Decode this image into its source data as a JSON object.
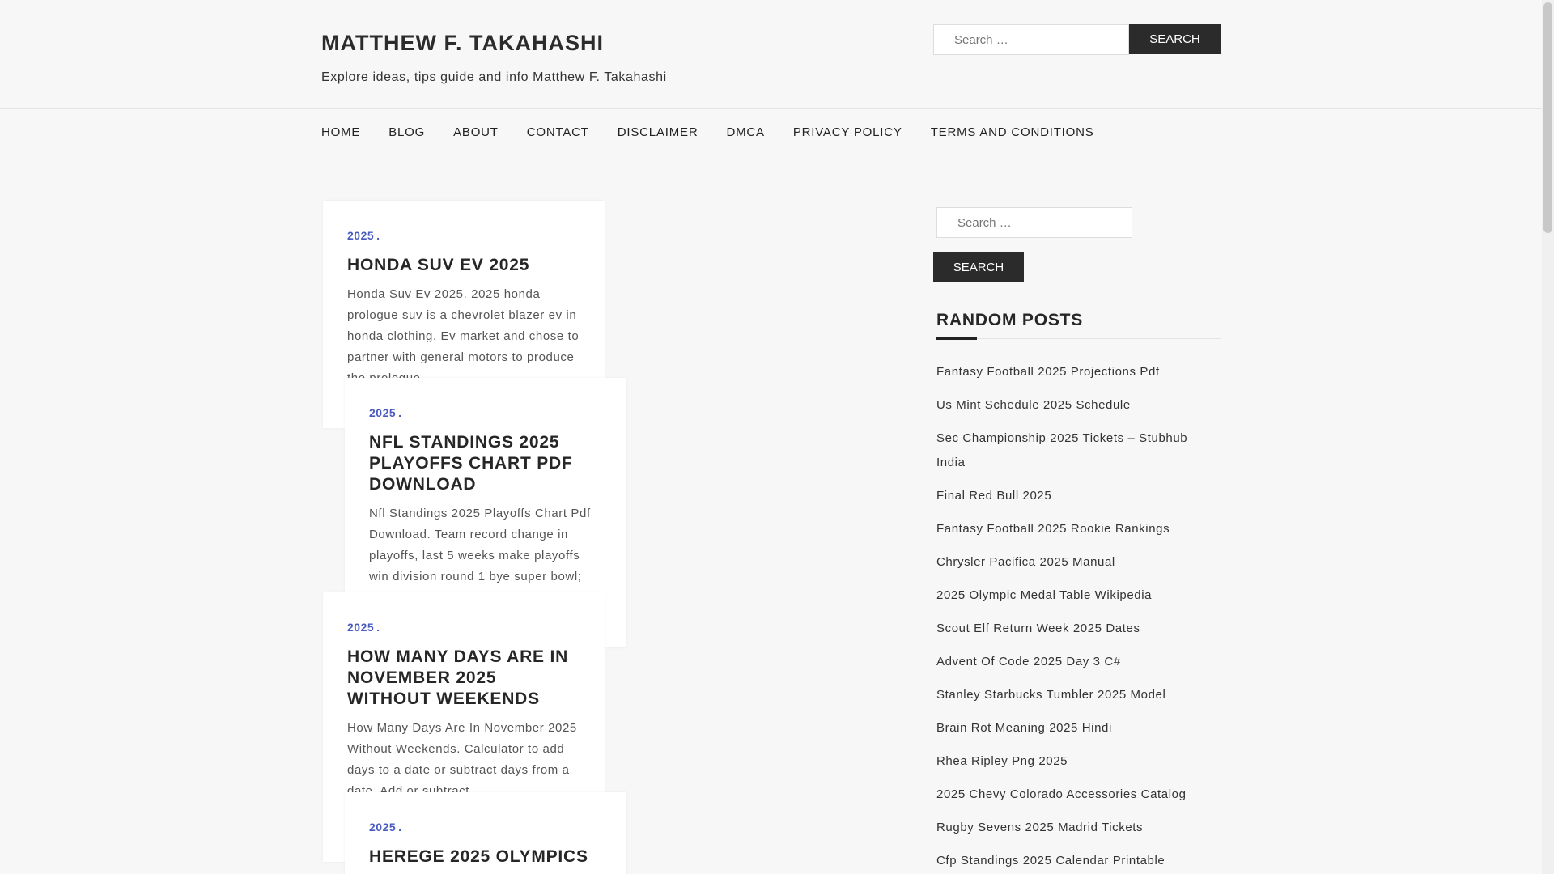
{
  "site": {
    "title": "MATTHEW F. TAKAHASHI",
    "description": "Explore ideas, tips guide and info Matthew F. Takahashi"
  },
  "header_search": {
    "placeholder": "Search …",
    "button": "Search"
  },
  "nav": [
    "HOME",
    "BLOG",
    "ABOUT",
    "CONTACT",
    "DISCLAIMER",
    "DMCA",
    "PRIVACY POLICY",
    "TERMS AND CONDITIONS"
  ],
  "posts": [
    {
      "category": "2025",
      "title": "HONDA SUV EV 2025",
      "excerpt": "Honda Suv Ev 2025. 2025 honda prologue suv is a chevrolet blazer ev in honda clothing. Ev market and chose to partner with general motors to produce the prologue."
    },
    {
      "category": "2025",
      "title": "NFL STANDINGS 2025 PLAYOFFS CHART PDF DOWNLOAD",
      "excerpt": "Nfl Standings 2025 Playoffs Chart Pdf Download. Team record change in playoffs, last 5 weeks make playoffs win division round 1 bye super bowl;"
    },
    {
      "category": "2025",
      "title": "HOW MANY DAYS ARE IN NOVEMBER 2025 WITHOUT WEEKENDS",
      "excerpt": "How Many Days Are In November 2025 Without Weekends. Calculator to add days to a date or subtract days from a date. Add or subtract"
    },
    {
      "category": "2025",
      "title": "HEREGE 2025 OLYMPICS",
      "excerpt": ""
    }
  ],
  "sidebar": {
    "search_placeholder": "Search …",
    "search_button": "Search",
    "random_title": "RANDOM POSTS",
    "random_posts": [
      "Fantasy Football 2025 Projections Pdf",
      "Us Mint Schedule 2025 Schedule",
      "Sec Championship 2025 Tickets – Stubhub India",
      "Final Red Bull 2025",
      "Fantasy Football 2025 Rookie Rankings",
      "Chrysler Pacifica 2025 Manual",
      "2025 Olympic Medal Table Wikipedia",
      "Scout Elf Return Week 2025 Dates",
      "Advent Of Code 2025 Day 3 C#",
      "Stanley Starbucks Tumbler 2025 Model",
      "Brain Rot Meaning 2025 Hindi",
      "Rhea Ripley Png 2025",
      "2025 Chevy Colorado Accessories Catalog",
      "Rugby Sevens 2025 Madrid Tickets",
      "Cfp Standings 2025 Calendar Printable"
    ]
  },
  "colors": {
    "accent": "#4a5bbf",
    "button_bg": "#2b2b2b",
    "background": "#f7f7f7"
  }
}
